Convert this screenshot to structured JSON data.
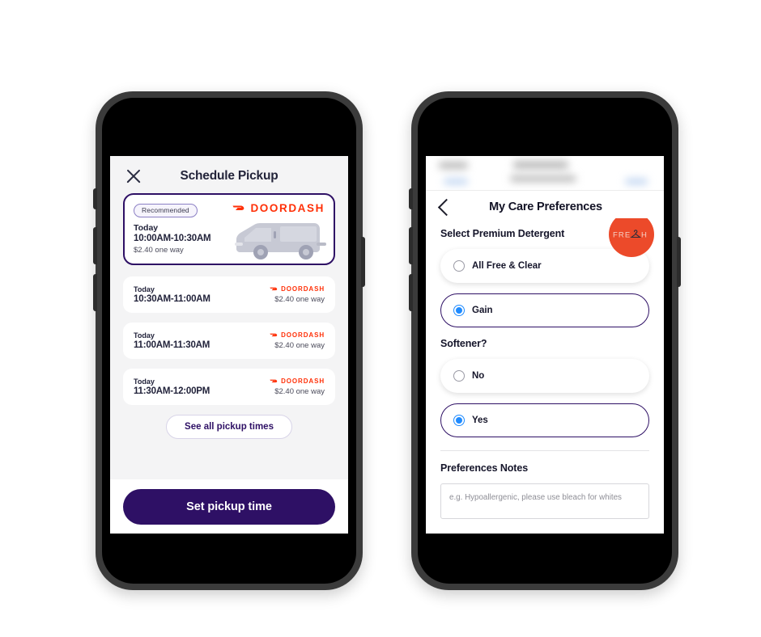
{
  "phone_left": {
    "name": "schedule-pickup-screen",
    "header": {
      "close_icon": "close-x-icon",
      "title": "Schedule Pickup"
    },
    "featured_slot": {
      "badge": "Recommended",
      "day": "Today",
      "time": "10:00AM-10:30AM",
      "price": "$2.40 one way",
      "provider": "DOORDASH",
      "provider_icon": "doordash-logo-icon",
      "vehicle_icon": "delivery-van-icon",
      "selected": true
    },
    "slots": [
      {
        "day": "Today",
        "time": "10:30AM-11:00AM",
        "provider": "DOORDASH",
        "price": "$2.40 one way"
      },
      {
        "day": "Today",
        "time": "11:00AM-11:30AM",
        "provider": "DOORDASH",
        "price": "$2.40 one way"
      },
      {
        "day": "Today",
        "time": "11:30AM-12:00PM",
        "provider": "DOORDASH",
        "price": "$2.40 one way"
      }
    ],
    "see_all_label": "See all pickup times",
    "primary_button": "Set pickup time"
  },
  "phone_right": {
    "name": "care-preferences-screen",
    "header": {
      "back_icon": "chevron-left-icon",
      "title": "My Care Preferences"
    },
    "brand": {
      "logo_text": "FRE",
      "logo_text_end": "H",
      "logo_icon": "clothes-hanger-icon",
      "color": "#ec4a2a"
    },
    "detergent": {
      "label": "Select Premium Detergent",
      "options": [
        {
          "label": "All Free & Clear",
          "selected": false
        },
        {
          "label": "Gain",
          "selected": true
        }
      ]
    },
    "softener": {
      "label": "Softener?",
      "options": [
        {
          "label": "No",
          "selected": false
        },
        {
          "label": "Yes",
          "selected": true
        }
      ]
    },
    "notes": {
      "label": "Preferences Notes",
      "placeholder": "e.g. Hypoallergenic, please use bleach for whites",
      "value": ""
    }
  },
  "colors": {
    "brand_purple": "#2e1065",
    "doordash_red": "#ff3008",
    "radio_blue": "#1f8bff",
    "fresh_orange": "#ec4a2a"
  }
}
